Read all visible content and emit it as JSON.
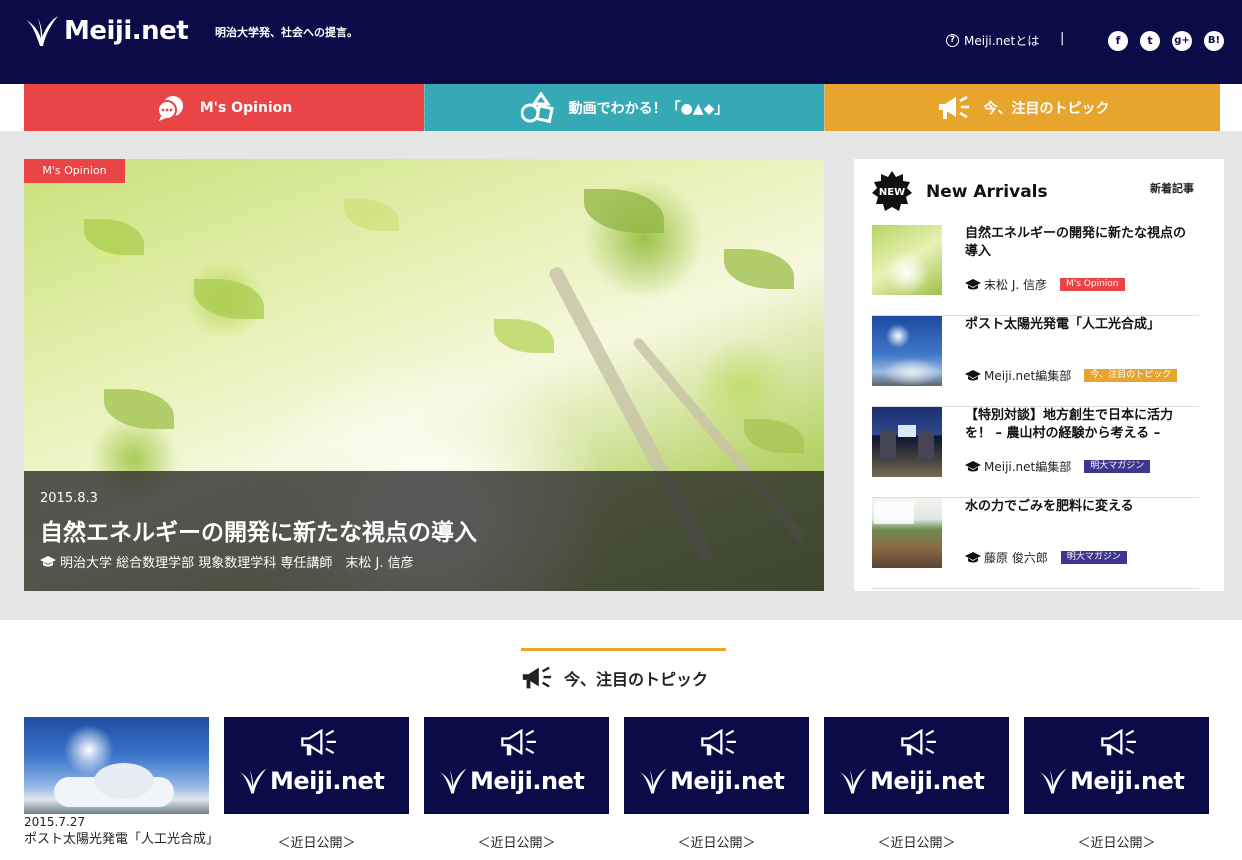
{
  "header": {
    "logo_text": "Meiji.net",
    "tagline": "明治大学発、社会への提言。",
    "about_label": "Meiji.netとは",
    "divider": "|",
    "social": [
      {
        "icon": "facebook-icon",
        "glyph": "f"
      },
      {
        "icon": "twitter-icon",
        "glyph": "t"
      },
      {
        "icon": "googleplus-icon",
        "glyph": "g+"
      },
      {
        "icon": "hatena-bookmark-icon",
        "glyph": "B!"
      }
    ]
  },
  "nav": {
    "opinion": "M's Opinion",
    "video": "動画でわかる！「●▲◆」",
    "topic": "今、注目のトピック"
  },
  "hero": {
    "badge": "M's Opinion",
    "date": "2015.8.3",
    "title": "自然エネルギーの開発に新たな視点の導入",
    "author": "明治大学 総合数理学部 現象数理学科 専任講師　末松 J. 信彦"
  },
  "arrivals": {
    "badge": "NEW",
    "title": "New Arrivals",
    "subtitle": "新着記事",
    "items": [
      {
        "title": "自然エネルギーの開発に新たな視点の導入",
        "author": "末松 J. 信彦",
        "tag": "M's Opinion"
      },
      {
        "title": "ポスト太陽光発電「人工光合成」",
        "author": "Meiji.net編集部",
        "tag": "今、注目のトピック"
      },
      {
        "title": "【特別対談】地方創生で日本に活力を！ – 農山村の経験から考える –",
        "author": "Meiji.net編集部",
        "tag": "明大マガジン"
      },
      {
        "title": "水の力でごみを肥料に変える",
        "author": "藤原 俊六郎",
        "tag": "明大マガジン"
      }
    ]
  },
  "topics": {
    "heading": "今、注目のトピック",
    "first": {
      "date": "2015.7.27",
      "title": "ポスト太陽光発電「人工光合成」"
    },
    "placeholder_logo": "Meiji.net",
    "coming_soon": "＜近日公開＞"
  },
  "colors": {
    "navy": "#0b0b48",
    "red": "#e94446",
    "teal": "#35a9b5",
    "orange": "#e7a52d",
    "purple": "#3d358e"
  }
}
